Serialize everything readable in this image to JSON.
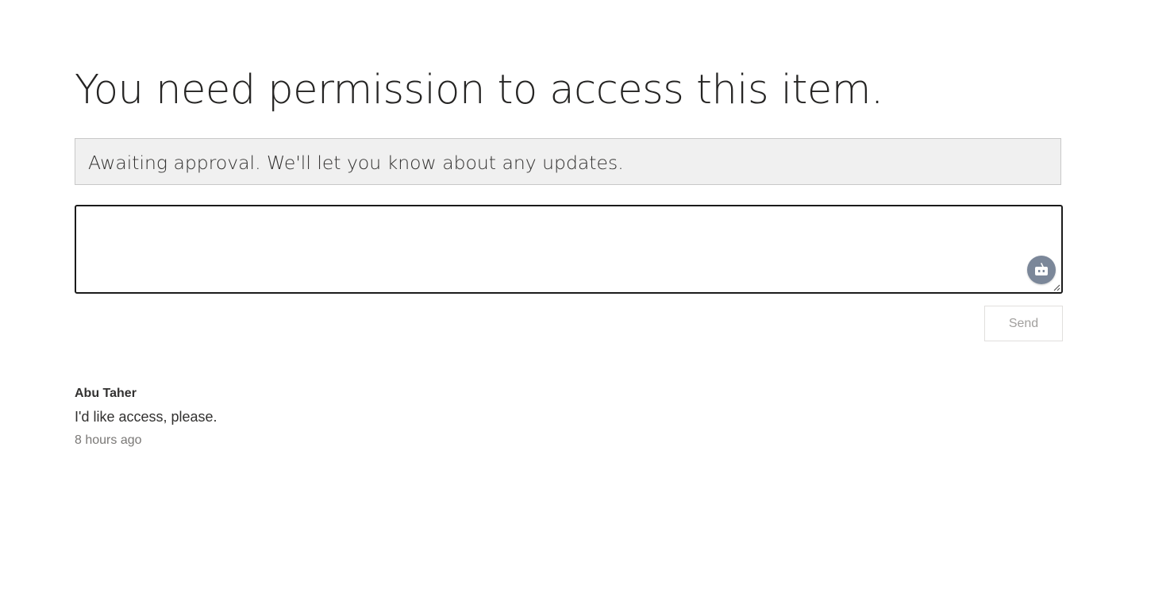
{
  "page": {
    "title": "You need permission to access this item."
  },
  "status": {
    "message": "Awaiting approval. We'll let you know about any updates."
  },
  "message_box": {
    "value": "",
    "placeholder": "",
    "assistant_icon": "robot-icon",
    "resize_icon": "resize-grip-icon"
  },
  "actions": {
    "send_label": "Send"
  },
  "requests": [
    {
      "author": "Abu Taher",
      "message": "I'd like access, please.",
      "time": "8 hours ago"
    }
  ],
  "colors": {
    "status_background": "#f0f0f0",
    "textarea_border": "#1b1b1b",
    "assistant_badge": "#7b8799",
    "send_disabled_text": "#a19f9d"
  }
}
